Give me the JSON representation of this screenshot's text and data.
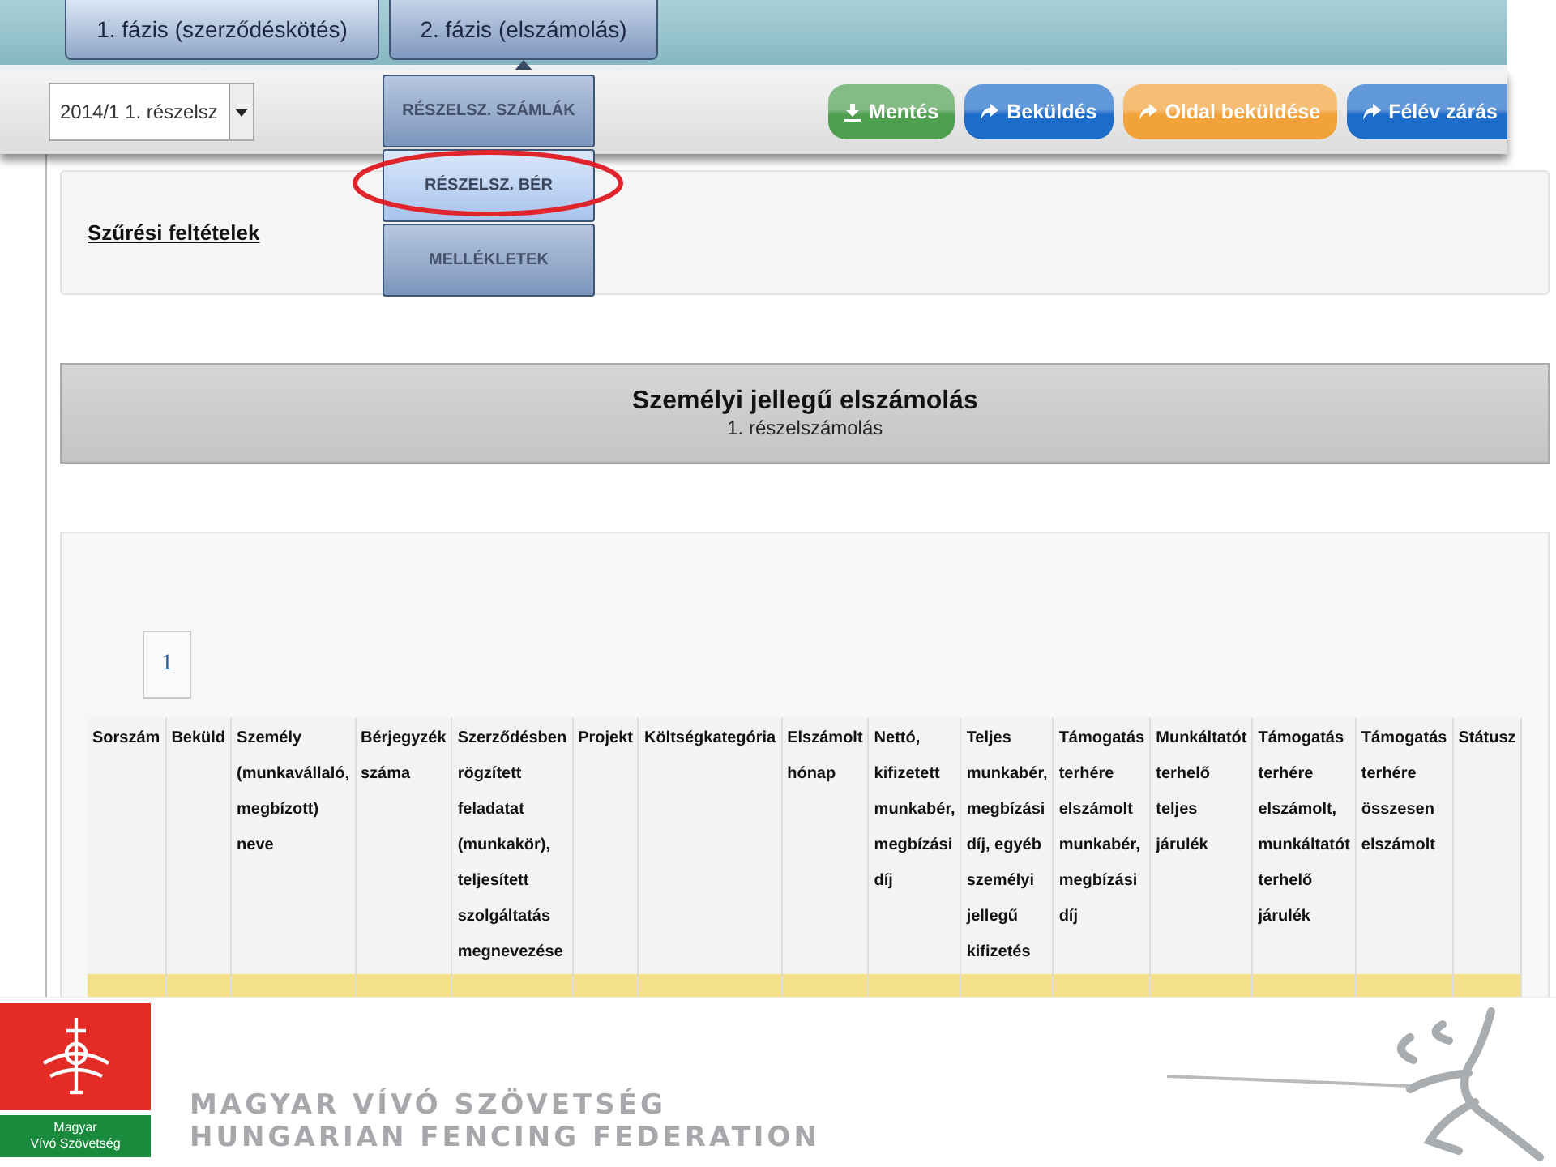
{
  "phase_tabs": [
    {
      "label": "1. fázis (szerződéskötés)",
      "selected": false
    },
    {
      "label": "2. fázis (elszámolás)",
      "selected": true
    }
  ],
  "period_select": {
    "value": "2014/1 1. részelsz"
  },
  "submenu": [
    {
      "label": "RÉSZELSZ. SZÁMLÁK",
      "selected": false
    },
    {
      "label": "RÉSZELSZ. BÉR",
      "selected": true
    },
    {
      "label": "MELLÉKLETEK",
      "selected": false
    }
  ],
  "action_buttons": [
    {
      "label": "Mentés",
      "kind": "save",
      "color": "#4f9f50"
    },
    {
      "label": "Beküldés",
      "kind": "send",
      "color": "#1c6cc9"
    },
    {
      "label": "Oldal beküldése",
      "kind": "send",
      "color": "#f2a23a"
    },
    {
      "label": "Félév zárás",
      "kind": "send",
      "color": "#1c6cc9"
    }
  ],
  "filter_panel": {
    "link": "Szűrési feltételek"
  },
  "heading": {
    "title": "Személyi jellegű elszámolás",
    "subtitle": "1. részelszámolás"
  },
  "pagination": [
    {
      "label": "1",
      "selected": true
    }
  ],
  "table": {
    "columns": [
      "Sorszám",
      "Beküld",
      "Személy (munkavállaló, megbízott) neve",
      "Bérjegyzék száma",
      "Szerződésben rögzített feladatat (munkakör), teljesített szolgáltatás megnevezése",
      "Projekt",
      "Költségkategória",
      "Elszámolt hónap",
      "Nettó, kifizetett munkabér, megbízási díj",
      "Teljes munkabér, megbízási díj, egyéb személyi jellegű kifizetés",
      "Támogatás terhére elszámolt munkabér, megbízási díj",
      "Munkáltatót terhelő teljes járulék",
      "Támogatás terhére elszámolt, munkáltatót terhelő járulék",
      "Támogatás terhére összesen elszámolt",
      "Státusz"
    ]
  },
  "footer": {
    "logo_label": [
      "Magyar",
      "Vívó Szövetség"
    ],
    "federation_name": [
      "MAGYAR VÍVÓ SZÖVETSÉG",
      "HUNGARIAN FENCING FEDERATION"
    ]
  }
}
